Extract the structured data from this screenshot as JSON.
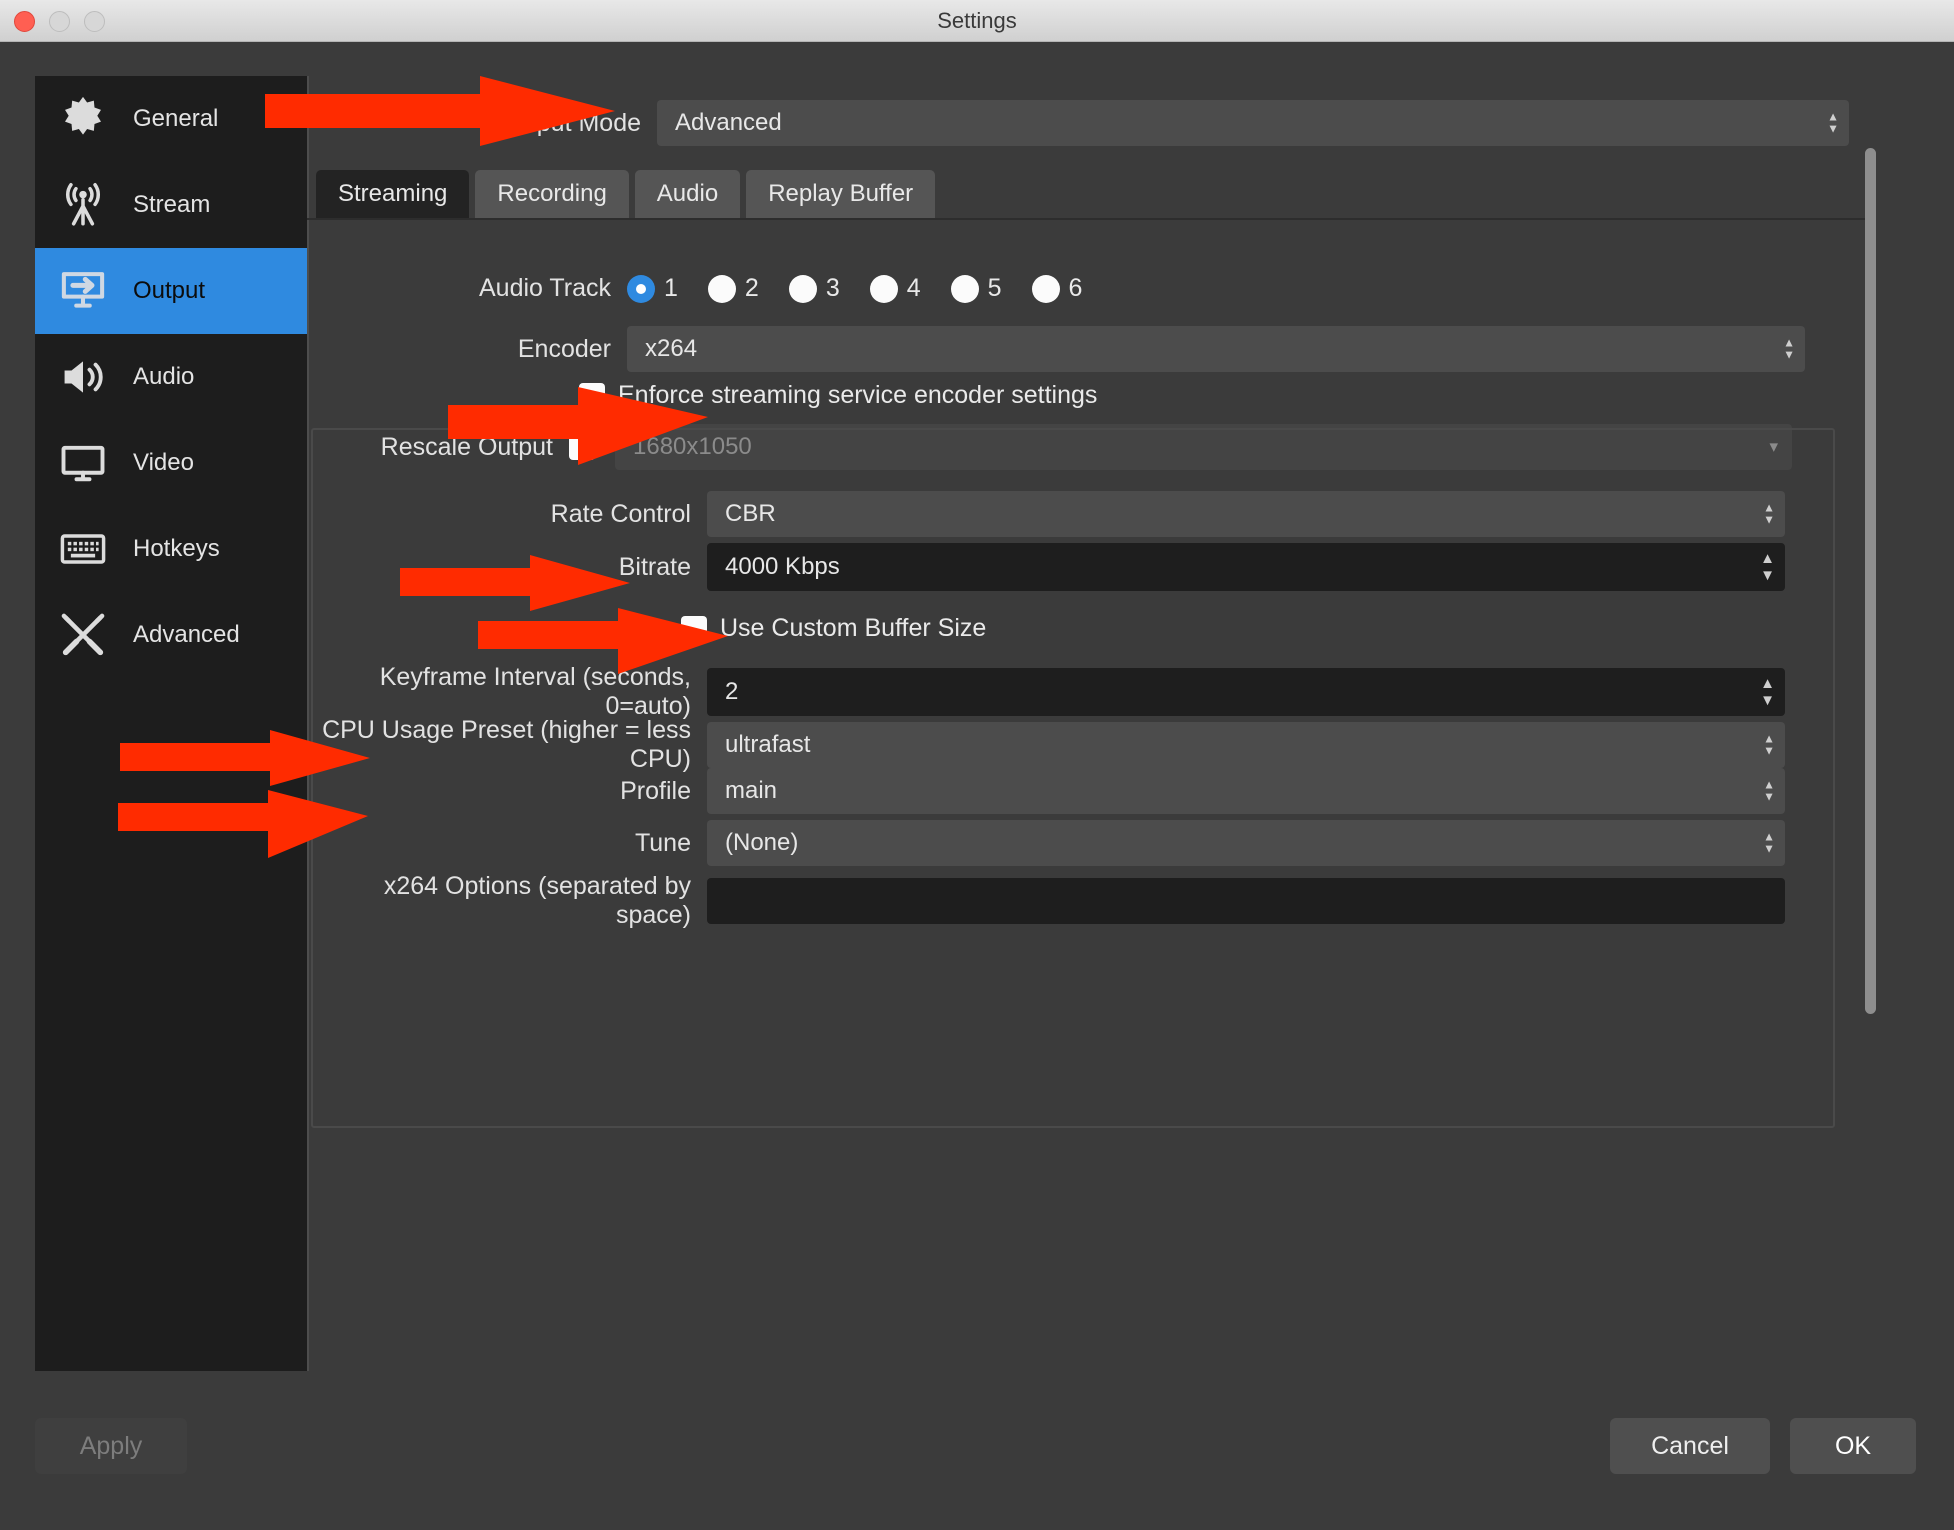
{
  "window": {
    "title": "Settings"
  },
  "traffic": {
    "close": "close-button",
    "minimize": "minimize-button",
    "zoom": "zoom-button"
  },
  "sidebar": {
    "items": [
      {
        "label": "General",
        "icon": "gear-icon",
        "active": false
      },
      {
        "label": "Stream",
        "icon": "antenna-icon",
        "active": false
      },
      {
        "label": "Output",
        "icon": "monitor-arrow-icon",
        "active": true
      },
      {
        "label": "Audio",
        "icon": "speaker-icon",
        "active": false
      },
      {
        "label": "Video",
        "icon": "display-icon",
        "active": false
      },
      {
        "label": "Hotkeys",
        "icon": "keyboard-icon",
        "active": false
      },
      {
        "label": "Advanced",
        "icon": "tools-icon",
        "active": false
      }
    ]
  },
  "output_mode": {
    "label": "Output Mode",
    "value": "Advanced"
  },
  "tabs": [
    {
      "label": "Streaming",
      "active": true
    },
    {
      "label": "Recording",
      "active": false
    },
    {
      "label": "Audio",
      "active": false
    },
    {
      "label": "Replay Buffer",
      "active": false
    }
  ],
  "form": {
    "audio_track": {
      "label": "Audio Track",
      "options": [
        "1",
        "2",
        "3",
        "4",
        "5",
        "6"
      ],
      "selected": "1"
    },
    "encoder": {
      "label": "Encoder",
      "value": "x264"
    },
    "enforce": {
      "label": "Enforce streaming service encoder settings",
      "checked": false
    },
    "rescale": {
      "label": "Rescale Output",
      "checked": false,
      "value": "1680x1050",
      "disabled": true
    },
    "rate_control": {
      "label": "Rate Control",
      "value": "CBR"
    },
    "bitrate": {
      "label": "Bitrate",
      "value": "4000 Kbps"
    },
    "custom_buffer": {
      "label": "Use Custom Buffer Size",
      "checked": false
    },
    "keyframe": {
      "label": "Keyframe Interval (seconds, 0=auto)",
      "value": "2"
    },
    "cpu_preset": {
      "label": "CPU Usage Preset (higher = less CPU)",
      "value": "ultrafast"
    },
    "profile": {
      "label": "Profile",
      "value": "main"
    },
    "tune": {
      "label": "Tune",
      "value": "(None)"
    },
    "x264_options": {
      "label": "x264 Options (separated by space)",
      "value": ""
    }
  },
  "buttons": {
    "apply": "Apply",
    "cancel": "Cancel",
    "ok": "OK"
  },
  "colors": {
    "accent": "#2f8ae0",
    "annotation": "#ff2b00",
    "window_bg": "#3b3b3b",
    "sidebar_bg": "#1d1d1d"
  },
  "annotations": {
    "arrows": [
      "output-mode-arrow",
      "enforce-checkbox-arrow",
      "rate-control-arrow",
      "bitrate-arrow",
      "keyframe-arrow",
      "cpu-preset-arrow"
    ]
  }
}
